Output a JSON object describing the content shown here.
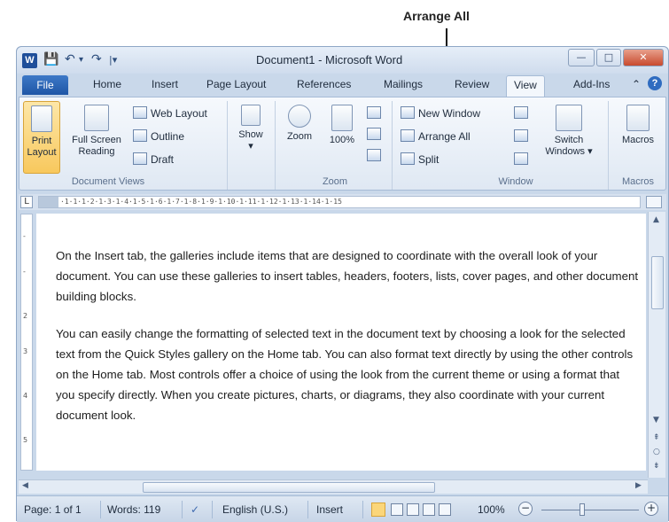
{
  "annotation": {
    "label": "Arrange All"
  },
  "window": {
    "title": "Document1 - Microsoft Word",
    "app_icon": "W",
    "min_label": "—",
    "max_label": "□",
    "close_label": "✕"
  },
  "quick_access": {
    "save_icon": "💾",
    "undo_icon": "↶",
    "undo_dropdown": "▾",
    "redo_icon": "↷",
    "customize_icon": "|▾"
  },
  "tabs": [
    {
      "label": "File"
    },
    {
      "label": "Home"
    },
    {
      "label": "Insert"
    },
    {
      "label": "Page Layout"
    },
    {
      "label": "References"
    },
    {
      "label": "Mailings"
    },
    {
      "label": "Review"
    },
    {
      "label": "View"
    },
    {
      "label": "Add-Ins"
    }
  ],
  "tab_extras": {
    "minimize_icon": "⌃",
    "help_icon": "?"
  },
  "ribbon": {
    "document_views": {
      "label": "Document Views",
      "print_layout": "Print\nLayout",
      "full_screen": "Full Screen\nReading",
      "web_layout": "Web Layout",
      "outline": "Outline",
      "draft": "Draft"
    },
    "show": {
      "label": "Show",
      "arrow": "▾"
    },
    "zoom": {
      "label": "Zoom",
      "zoom_button": "Zoom",
      "hundred": "100%"
    },
    "window": {
      "label": "Window",
      "new_window": "New Window",
      "arrange_all": "Arrange All",
      "split": "Split",
      "switch_windows": "Switch\nWindows ▾"
    },
    "macros": {
      "label": "Macros",
      "button": "Macros"
    }
  },
  "ruler": {
    "corner": "L",
    "marks": "·1·1·1·2·1·3·1·4·1·5·1·6·1·7·1·8·1·9·1·10·1·11·1·12·1·13·1·14·1·15"
  },
  "document": {
    "paragraphs": [
      "On the Insert tab, the galleries include items that are designed to coordinate with the overall look of your document. You can use these galleries to insert tables, headers, footers, lists, cover pages, and other document building blocks.",
      "You can easily change the formatting of selected text in the document text by choosing a look for the selected text from the Quick Styles gallery on the Home tab. You can also format text directly by using the other controls on the Home tab. Most controls offer a choice of using the look from the current theme or using a format that you specify directly. When you create pictures, charts, or diagrams, they also coordinate with your current document look."
    ]
  },
  "statusbar": {
    "page": "Page: 1 of 1",
    "words": "Words: 119",
    "language": "English (U.S.)",
    "mode": "Insert",
    "zoom": "100%",
    "zoom_minus": "−",
    "zoom_plus": "+"
  }
}
